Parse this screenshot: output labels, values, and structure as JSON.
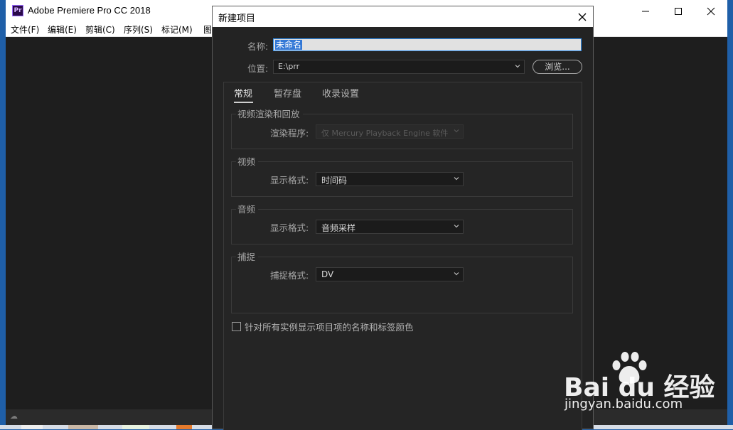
{
  "app": {
    "title": "Adobe Premiere Pro CC 2018",
    "icon_text": "Pr",
    "menu": [
      "文件(F)",
      "编辑(E)",
      "剪辑(C)",
      "序列(S)",
      "标记(M)",
      "图"
    ]
  },
  "dialog": {
    "title": "新建项目",
    "name_label": "名称:",
    "name_value": "未命名",
    "location_label": "位置:",
    "location_value": "E:\\prr",
    "browse_label": "浏览...",
    "tabs": [
      "常规",
      "暂存盘",
      "收录设置"
    ],
    "active_tab": "常规",
    "groups": {
      "render": {
        "title": "视频渲染和回放",
        "field_label": "渲染程序:",
        "value": "仅 Mercury Playback Engine 软件",
        "disabled": true
      },
      "video": {
        "title": "视频",
        "field_label": "显示格式:",
        "value": "时间码"
      },
      "audio": {
        "title": "音频",
        "field_label": "显示格式:",
        "value": "音频采样"
      },
      "capture": {
        "title": "捕捉",
        "field_label": "捕捉格式:",
        "value": "DV"
      }
    },
    "checkbox_label": "针对所有实例显示项目项的名称和标签颜色",
    "checkbox_checked": false
  },
  "watermark": {
    "brand": "Bai du 经验",
    "url": "jingyan.baidu.com"
  },
  "colors": {
    "dialog_bg": "#232323",
    "accent_focus": "#2d8ceb",
    "selection": "#3378d6",
    "desktop": "#1f5fa8"
  }
}
